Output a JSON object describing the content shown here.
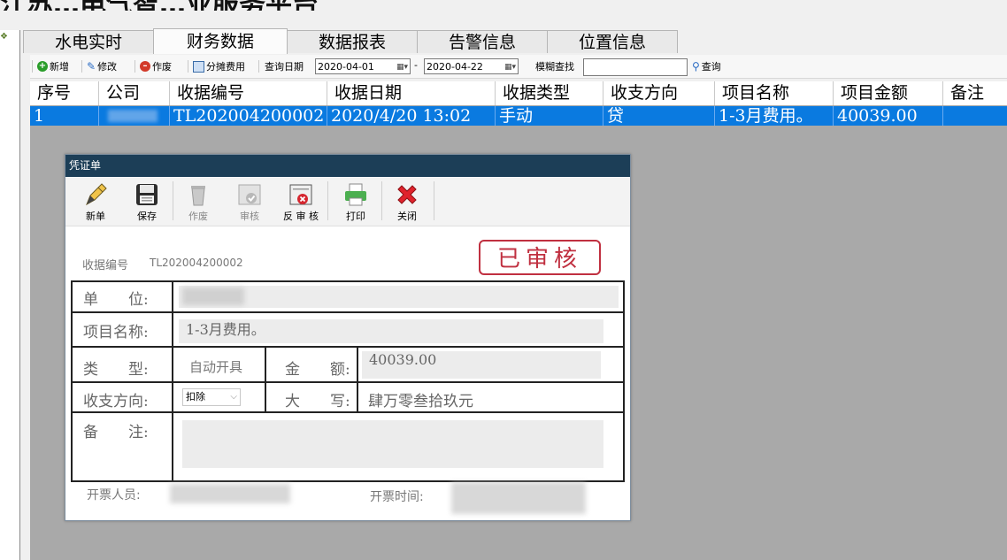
{
  "app": {
    "title": "江苏…电气智…业服务平台"
  },
  "tabs": [
    "水电实时",
    "财务数据",
    "数据报表",
    "告警信息",
    "位置信息"
  ],
  "active_tab": "财务数据",
  "toolbar": {
    "add": "新增",
    "edit": "修改",
    "void": "作废",
    "split": "分摊费用",
    "query_date_label": "查询日期",
    "date_from": "2020-04-01",
    "dash": "-",
    "date_to": "2020-04-22",
    "fuzzy_label": "模糊查找",
    "search_value": "",
    "query_button": "查询"
  },
  "grid": {
    "columns": [
      "序号",
      "公司",
      "收据编号",
      "收据日期",
      "收据类型",
      "收支方向",
      "项目名称",
      "项目金额",
      "备注"
    ],
    "rows": [
      {
        "index": "1",
        "company": "",
        "receipt_no": "TL202004200002",
        "date": "2020/4/20 13:02",
        "type": "手动",
        "direction": "贷",
        "item": "1-3月费用。",
        "amount": "40039.00",
        "note": ""
      }
    ]
  },
  "dialog": {
    "title": "凭证单",
    "tools": [
      {
        "label": "新单",
        "icon": "pen-icon",
        "enabled": true
      },
      {
        "label": "保存",
        "icon": "floppy-icon",
        "enabled": true
      },
      {
        "label": "作废",
        "icon": "trash-icon",
        "enabled": false
      },
      {
        "label": "审核",
        "icon": "approve-icon",
        "enabled": false
      },
      {
        "label": "反 审 核",
        "icon": "unapprove-icon",
        "enabled": true
      },
      {
        "label": "打印",
        "icon": "printer-icon",
        "enabled": true
      },
      {
        "label": "关闭",
        "icon": "close-icon",
        "enabled": true
      }
    ],
    "receipt_no_label": "收据编号",
    "receipt_no": "TL202004200002",
    "stamp": "已审核",
    "form": {
      "unit_label": "单　　位:",
      "unit_value": "",
      "item_label": "项目名称:",
      "item_value": "1-3月费用。",
      "type_label": "类　　型:",
      "type_value": "自动开具",
      "amount_label": "金　　额:",
      "amount_value": "40039.00",
      "direction_label": "收支方向:",
      "direction_value": "扣除",
      "capital_label": "大　　写:",
      "capital_value": "肆万零叁拾玖元",
      "note_label": "备　　注:",
      "note_value": ""
    },
    "footer": {
      "issuer_label": "开票人员:",
      "time_label": "开票时间:"
    }
  },
  "colors": {
    "selection": "#0a7ae0",
    "dialog_title_bg": "#1c3e57",
    "stamp": "#c03040",
    "grid_bg": "#a9a9a9"
  }
}
